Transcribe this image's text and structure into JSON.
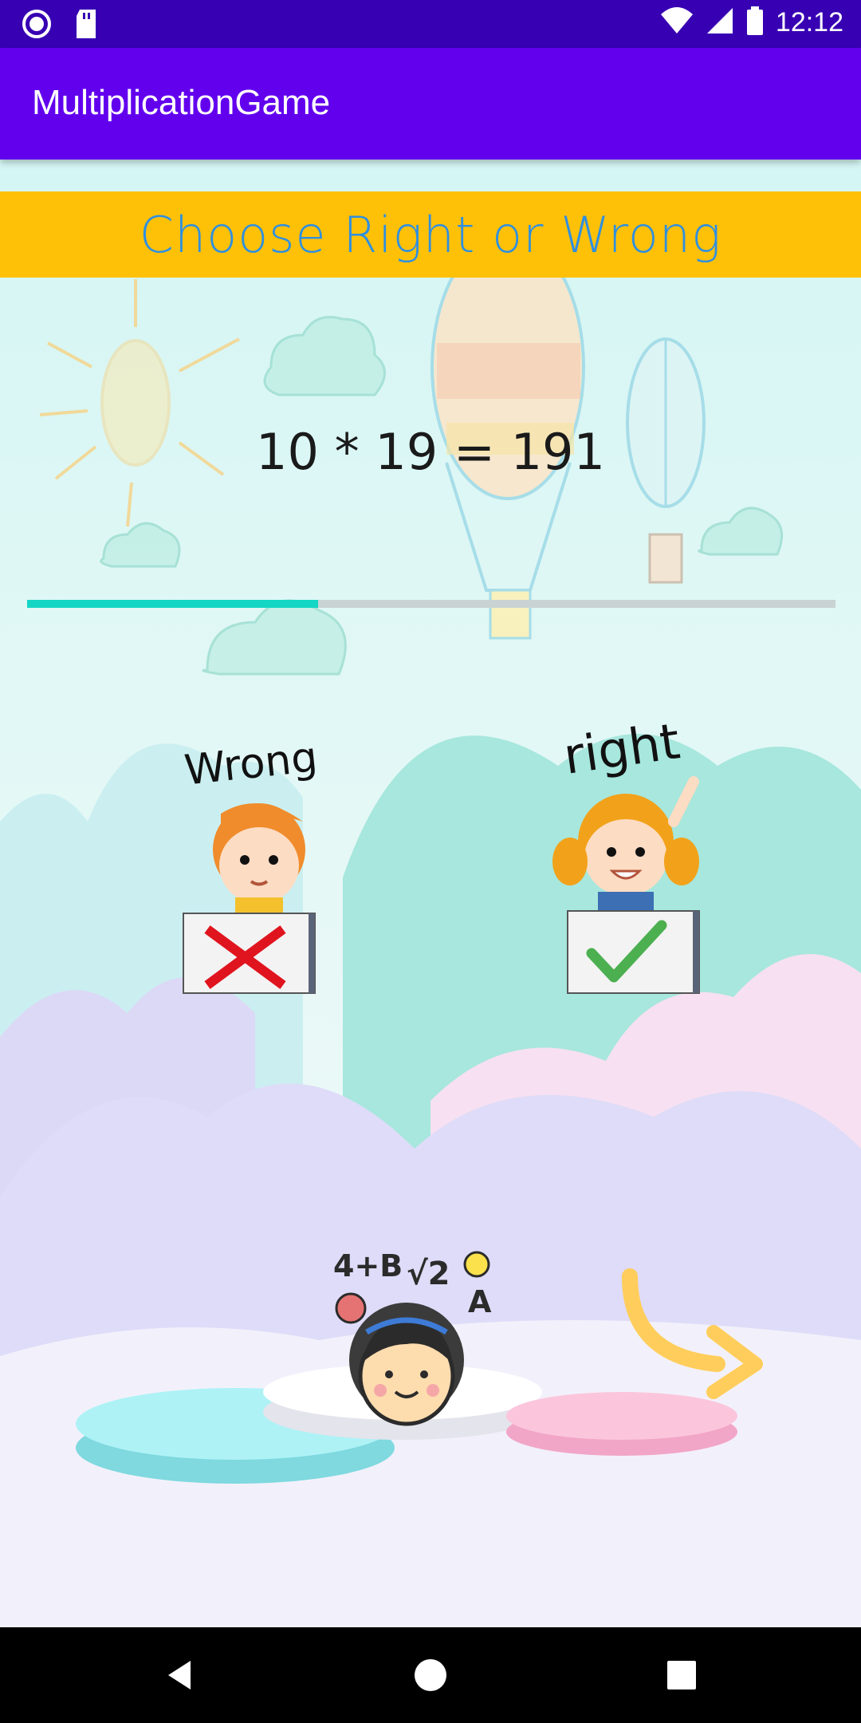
{
  "status_bar": {
    "time": "12:12"
  },
  "app_bar": {
    "title": "MultiplicationGame"
  },
  "banner": {
    "text": "Choose Right or Wrong"
  },
  "question": {
    "text": "10 * 19 = 191"
  },
  "progress": {
    "fraction": 0.36
  },
  "choices": {
    "wrong": {
      "label": "Wrong"
    },
    "right": {
      "label": "right"
    }
  },
  "decor": {
    "math_symbols": [
      "4+B",
      "√2",
      "A"
    ]
  },
  "colors": {
    "status_bar": "#3700b3",
    "app_bar": "#6200ee",
    "banner": "#ffc107",
    "banner_text": "#2f8fe0",
    "progress_fill": "#14d6c4",
    "wrong_mark": "#e0141e",
    "right_mark": "#4caf50"
  },
  "icons": {
    "status_left": [
      "radio-icon",
      "sd-card-icon"
    ],
    "status_right": [
      "wifi-icon",
      "signal-icon",
      "battery-icon"
    ],
    "nav": [
      "back-icon",
      "home-icon",
      "recents-icon"
    ]
  }
}
